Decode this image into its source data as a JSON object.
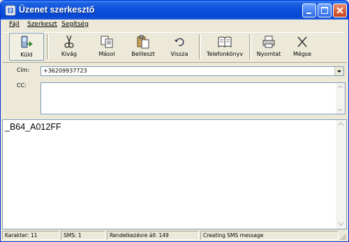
{
  "window": {
    "title": "Üzenet szerkesztő"
  },
  "menu": {
    "items": [
      "Fájl",
      "Szerkeszt",
      "Segítség"
    ]
  },
  "toolbar": {
    "buttons": [
      {
        "label": "Küld",
        "icon": "send-phone-icon"
      },
      {
        "label": "Kivág",
        "icon": "scissors-icon"
      },
      {
        "label": "Másol",
        "icon": "copy-icon"
      },
      {
        "label": "Beilleszt",
        "icon": "paste-icon"
      },
      {
        "label": "Vissza",
        "icon": "undo-icon"
      },
      {
        "label": "Telefonkönyv",
        "icon": "book-icon"
      },
      {
        "label": "Nyomtat",
        "icon": "printer-icon"
      },
      {
        "label": "Mégse",
        "icon": "cancel-x-icon"
      }
    ]
  },
  "header": {
    "to_label": "Cím:",
    "to_value": "+36209937723",
    "cc_label": "CC:",
    "cc_value": ""
  },
  "message": {
    "body": "_B64_A012FF"
  },
  "status": {
    "characters": "Karakter: 11",
    "sms": "SMS: 1",
    "available": "Rendelkezésre áll: 149",
    "message": "Creating SMS message"
  },
  "colors": {
    "titlebar": "#0a4fdc",
    "face": "#ece9d8",
    "border": "#7f9db9"
  }
}
